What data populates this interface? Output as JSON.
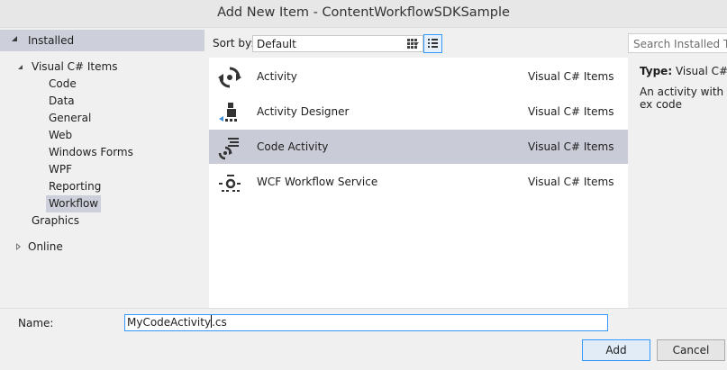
{
  "window": {
    "title": "Add New Item - ContentWorkflowSDKSample"
  },
  "tree": {
    "installed": "Installed",
    "visual_cs_items": "Visual C# Items",
    "children": [
      "Code",
      "Data",
      "General",
      "Web",
      "Windows Forms",
      "WPF",
      "Reporting",
      "Workflow"
    ],
    "graphics": "Graphics",
    "online": "Online"
  },
  "toolbar": {
    "sort_by_label": "Sort by:",
    "sort_value": "Default"
  },
  "items": [
    {
      "name": "Activity",
      "category": "Visual C# Items",
      "icon": "activity-icon"
    },
    {
      "name": "Activity Designer",
      "category": "Visual C# Items",
      "icon": "activity-designer-icon"
    },
    {
      "name": "Code Activity",
      "category": "Visual C# Items",
      "icon": "code-activity-icon"
    },
    {
      "name": "WCF Workflow Service",
      "category": "Visual C# Items",
      "icon": "wcf-workflow-service-icon"
    }
  ],
  "details": {
    "search_placeholder": "Search Installed Tem",
    "type_label": "Type:",
    "type_value": "Visual C# It",
    "description": "An activity with ex code"
  },
  "footer": {
    "name_label": "Name:",
    "name_value_before_caret": "MyCodeActivity",
    "name_value_after_caret": ".cs",
    "add_label": "Add",
    "cancel_label": "Cancel"
  },
  "colors": {
    "selection": "#cdd0da",
    "list_selection": "#c9cbd7",
    "focus_border": "#3399ff"
  }
}
